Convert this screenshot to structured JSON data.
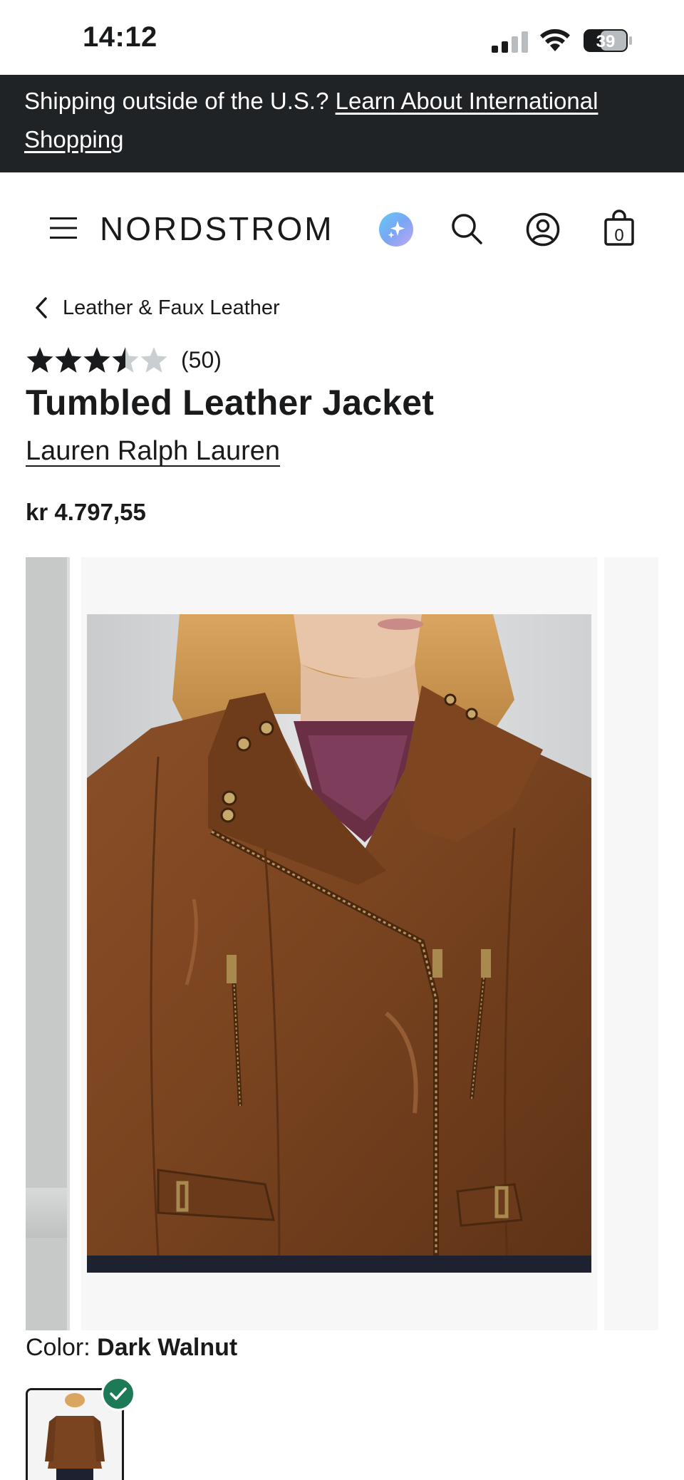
{
  "status_bar": {
    "time": "14:12",
    "battery_level": "39",
    "icons": [
      "cellular-signal-icon",
      "wifi-icon",
      "battery-icon"
    ]
  },
  "promo_banner": {
    "text": "Shipping outside of the U.S.? ",
    "link_text": "Learn About International Shopping",
    "background_color": "#1f2326"
  },
  "header": {
    "logo": "NORDSTROM",
    "icons": [
      "menu-icon",
      "ai-assistant-icon",
      "search-icon",
      "account-icon",
      "shopping-bag-icon"
    ],
    "bag_count": "0"
  },
  "breadcrumb": {
    "label": "Leather & Faux Leather"
  },
  "product": {
    "rating": 3.5,
    "rating_max": 5,
    "review_count": "(50)",
    "title": "Tumbled Leather Jacket",
    "brand": "Lauren Ralph Lauren",
    "price": "kr 4.797,55"
  },
  "color": {
    "label": "Color: ",
    "value": "Dark Walnut",
    "selected_check_color": "#1d7a56"
  },
  "colors": {
    "leather": "#7a4420",
    "text": "#191a1b",
    "star_filled": "#191a1b",
    "star_empty": "#c9ced1"
  }
}
